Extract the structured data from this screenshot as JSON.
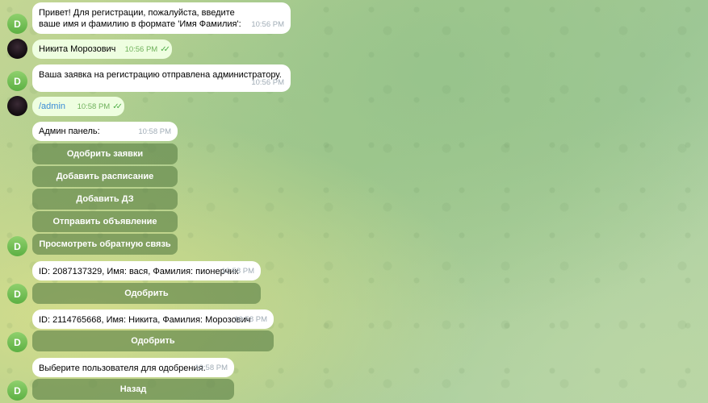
{
  "messages": {
    "m1": {
      "text": "Привет! Для регистрации, пожалуйста, введите ваше имя и фамилию в формате 'Имя Фамилия':",
      "time": "10:56 PM",
      "avatar": "D"
    },
    "m2": {
      "text": "Никита Морозович",
      "time": "10:56 PM"
    },
    "m3": {
      "text": "Ваша заявка на регистрацию отправлена администратору.",
      "time": "10:56 PM",
      "avatar": "D"
    },
    "m4": {
      "text": "/admin",
      "time": "10:58 PM"
    },
    "m5": {
      "text": "Админ панель:",
      "time": "10:58 PM",
      "avatar": "D",
      "buttons": [
        "Одобрить заявки",
        "Добавить расписание",
        "Добавить ДЗ",
        "Отправить объявление",
        "Просмотреть обратную связь"
      ]
    },
    "m6": {
      "text": "ID: 2087137329, Имя: вася, Фамилия: пионерчик",
      "time": "10:58 PM",
      "avatar": "D",
      "button": "Одобрить"
    },
    "m7": {
      "text": "ID: 2114765668, Имя: Никита, Фамилия: Морозович",
      "time": "10:58 PM",
      "avatar": "D",
      "button": "Одобрить"
    },
    "m8": {
      "text": "Выберите пользователя для одобрения.",
      "time": "10:58 PM",
      "avatar": "D",
      "button": "Назад"
    }
  },
  "colors": {
    "incoming_bubble": "#ffffff",
    "outgoing_bubble": "#eefee0",
    "bot_avatar": "#5cb043",
    "link": "#3a8bd6",
    "checkmarks": "#4faf47"
  },
  "icons": {
    "read_receipt": "double-check-icon"
  }
}
